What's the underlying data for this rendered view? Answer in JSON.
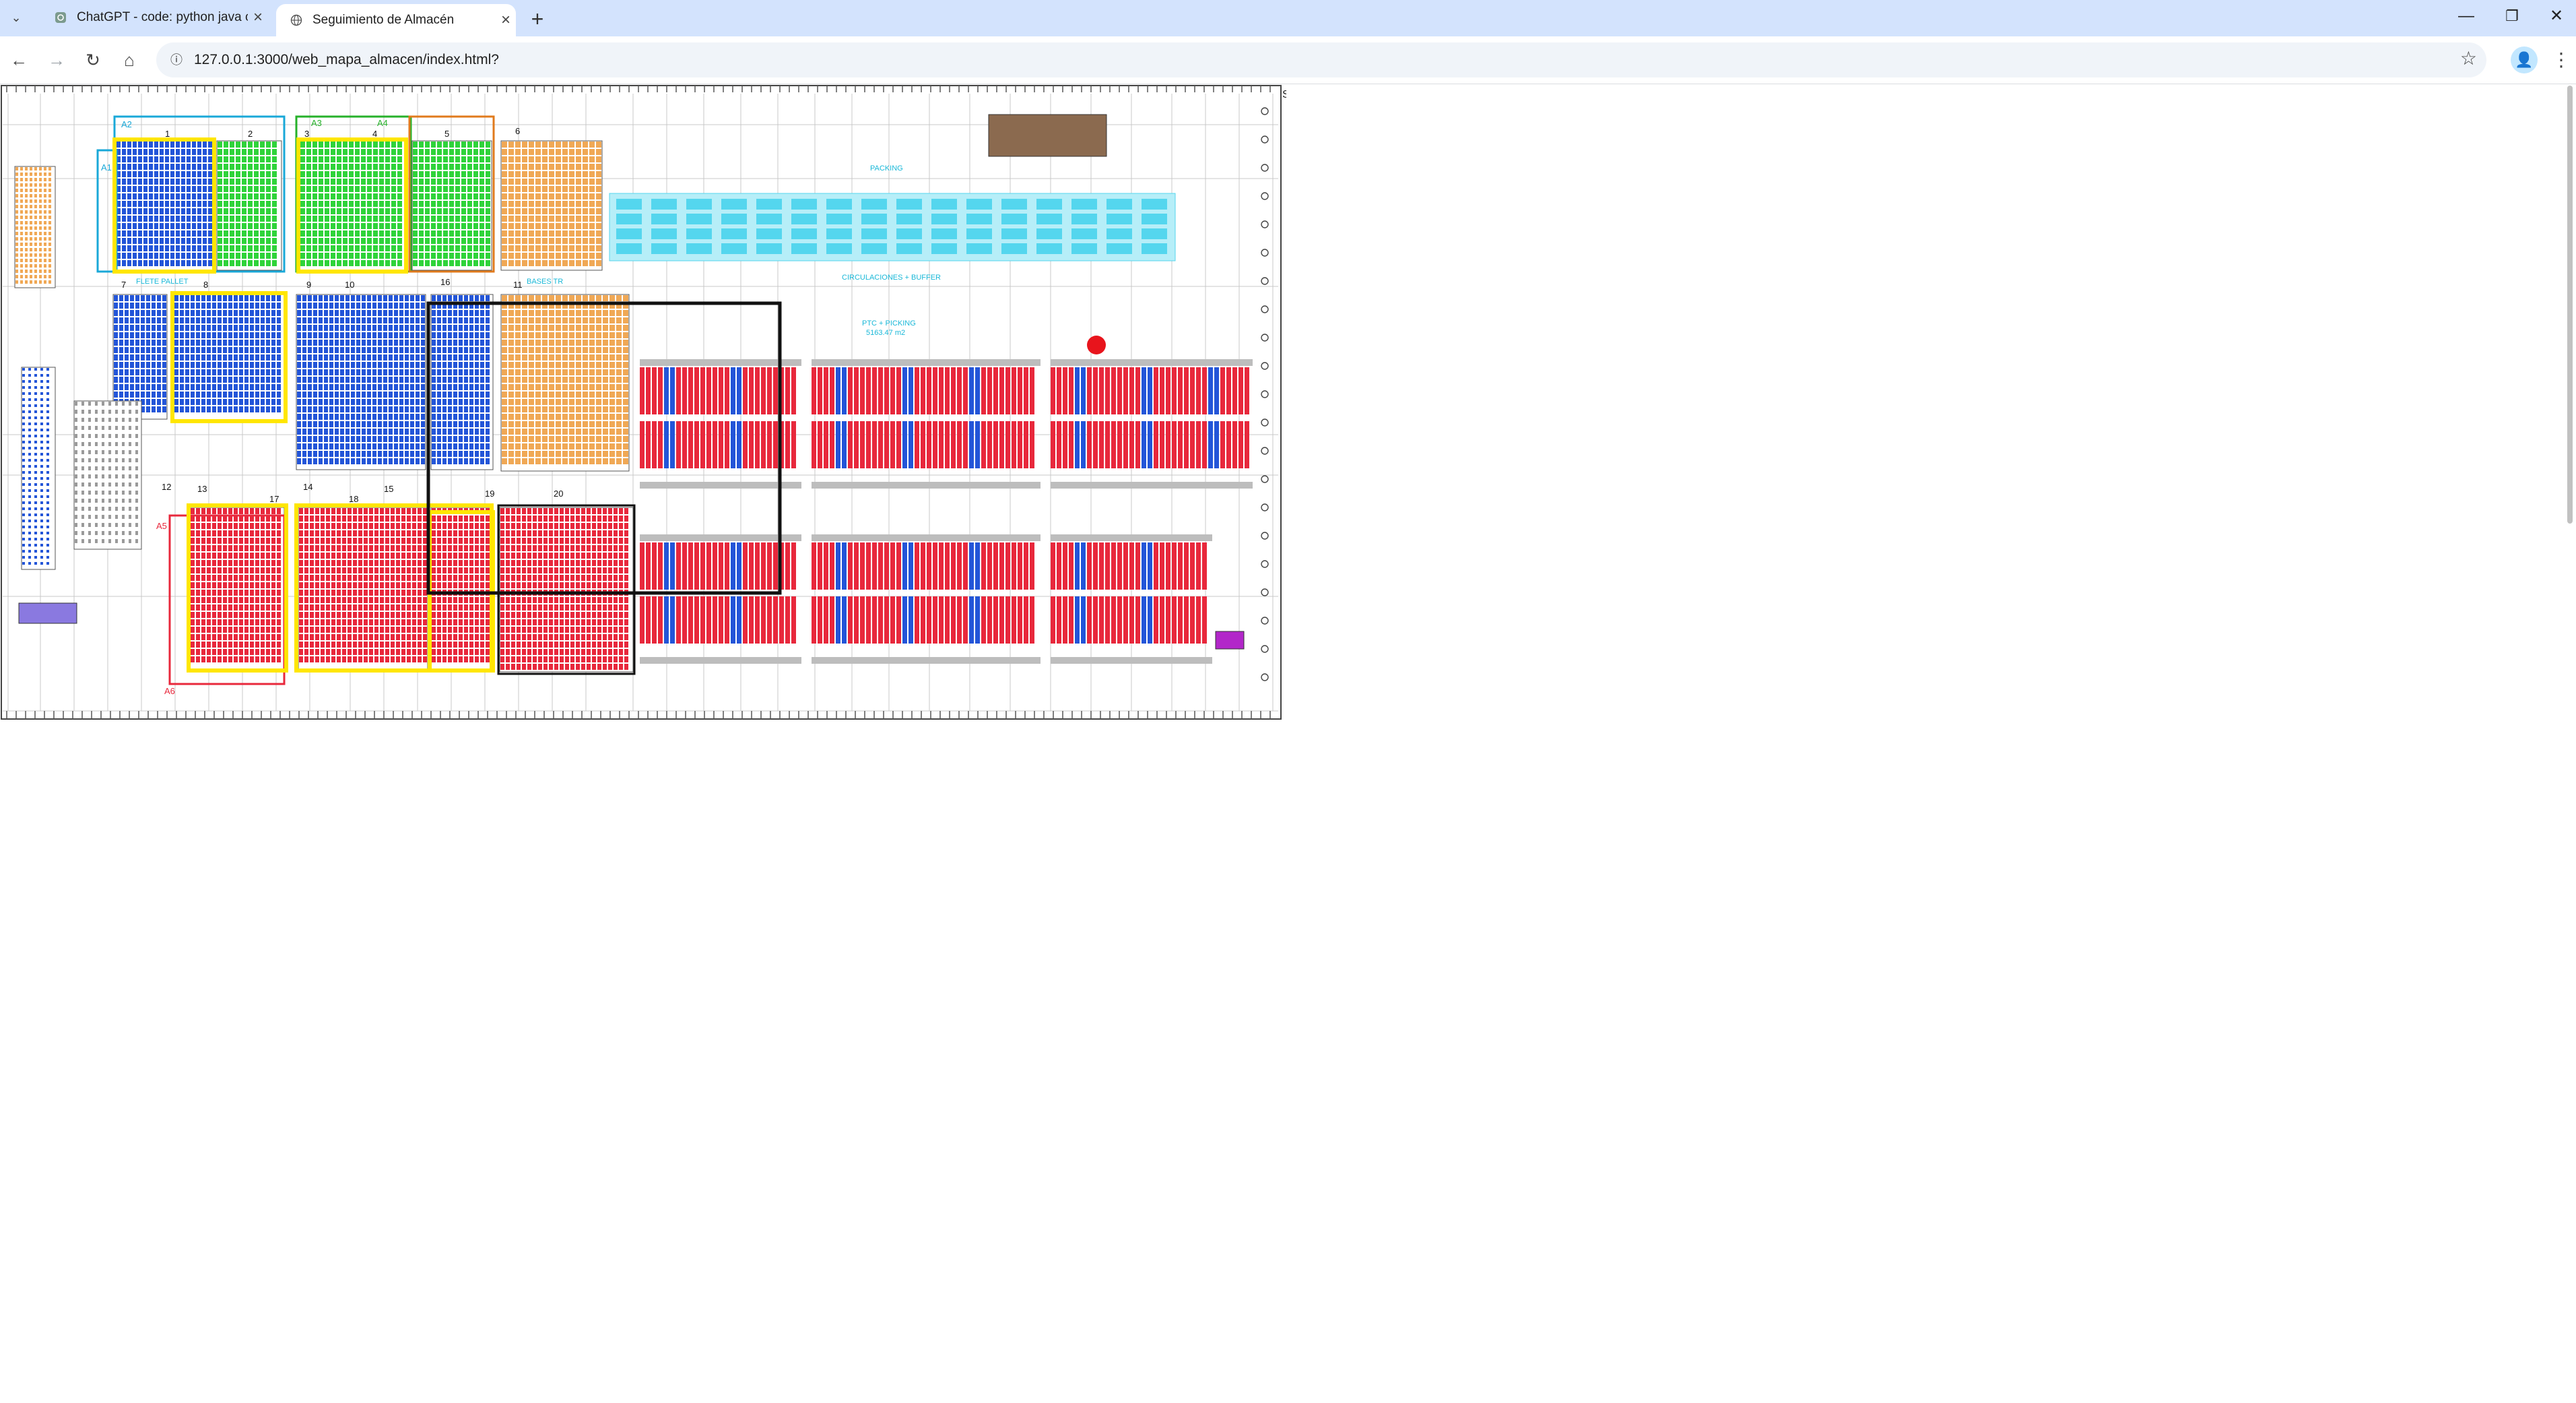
{
  "browser": {
    "tabs": [
      {
        "title": "ChatGPT - code: python java c",
        "active": false
      },
      {
        "title": "Seguimiento de Almacén",
        "active": true
      }
    ],
    "url": "127.0.0.1:3000/web_mapa_almacen/index.html?",
    "window_controls": {
      "minimize": "—",
      "restore": "❐",
      "close": "✕"
    }
  },
  "map": {
    "zone_labels": [
      "A1",
      "A2",
      "A3",
      "A4",
      "A5",
      "A6"
    ],
    "block_numbers": [
      "1",
      "2",
      "3",
      "4",
      "5",
      "6",
      "7",
      "8",
      "9",
      "10",
      "11",
      "12",
      "13",
      "14",
      "15",
      "16",
      "17",
      "18",
      "19",
      "20"
    ],
    "text_labels": {
      "packing": "PACKING",
      "circulaciones": "CIRCULACIONES + BUFFER",
      "almacen": "PTC + PICKING",
      "almacen_area": "5163.47 m2",
      "flete": "FLETE PALLET",
      "bases": "BASES TR",
      "right_edge": "S"
    },
    "marker": {
      "label": "current-position",
      "color": "#e8141c"
    },
    "colors": {
      "blue_rack": "#2355d8",
      "green_rack": "#2fd33a",
      "orange_rack": "#f0a855",
      "red_rack": "#e8283c",
      "cyan_area": "#54d6ee",
      "yellow_outline": "#ffe600",
      "black_outline": "#111111",
      "gray_aisle": "#9a9a9a"
    }
  }
}
